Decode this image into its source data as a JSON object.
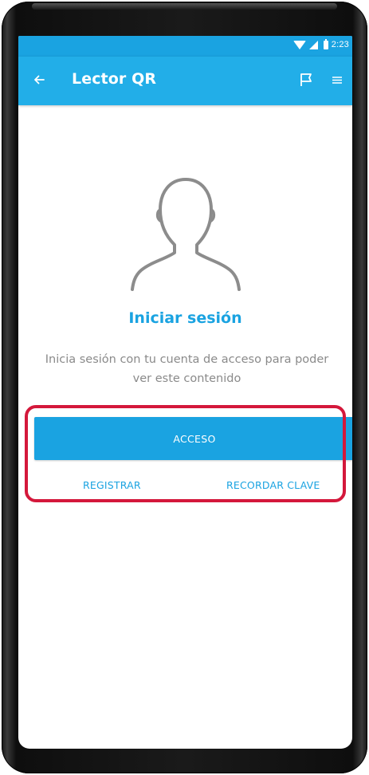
{
  "status_bar": {
    "time": "2:23",
    "icons": [
      "wifi-icon",
      "signal-icon",
      "battery-icon"
    ]
  },
  "toolbar": {
    "title": "Lector QR",
    "back_icon": "arrow-back-icon",
    "flag_icon": "flag-icon",
    "menu_icon": "menu-icon"
  },
  "login": {
    "avatar_icon": "user-outline-icon",
    "title": "Iniciar sesión",
    "description": "Inicia sesión con tu cuenta de acceso para poder ver este contenido",
    "access_label": "ACCESO",
    "register_label": "REGISTRAR",
    "recover_label": "RECORDAR CLAVE"
  },
  "colors": {
    "accent": "#1aa3e1",
    "toolbar": "#22aee8",
    "highlight": "#d4183b",
    "text_muted": "#8a8a8a"
  }
}
